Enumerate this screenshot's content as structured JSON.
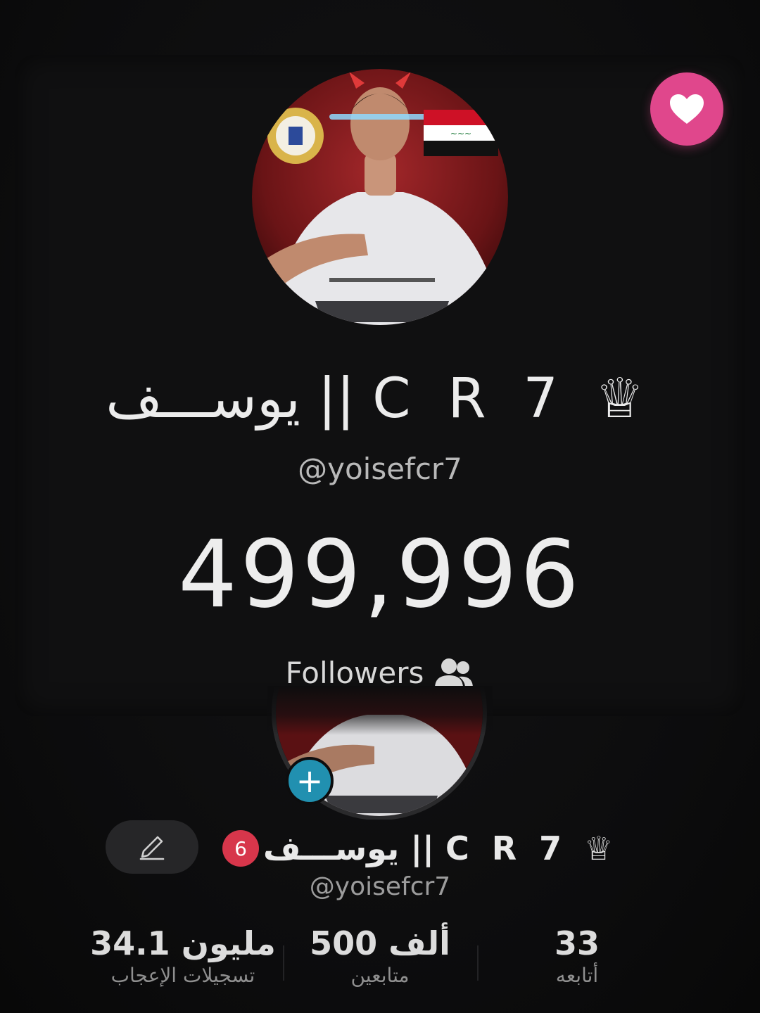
{
  "counter_card": {
    "display_name": "يوســـف || C R 7 ♕",
    "handle": "@yoisefcr7",
    "follower_count": "499,996",
    "followers_label": "Followers"
  },
  "profile": {
    "level": "6",
    "name": "يوســـف || C R 7 ♕",
    "handle": "@yoisefcr7",
    "stats": {
      "likes": {
        "value": "34.1 مليون",
        "label": "تسجيلات الإعجاب"
      },
      "followers": {
        "value": "500 ألف",
        "label": "متابعين"
      },
      "following": {
        "value": "33",
        "label": "أتابعه"
      }
    }
  },
  "colors": {
    "heart_button": "#e0478c",
    "add_button": "#2190b0",
    "level_badge": "#d7364b"
  },
  "icons": [
    "heart-icon",
    "users-icon",
    "plus-icon",
    "pencil-icon",
    "crown-icon"
  ]
}
